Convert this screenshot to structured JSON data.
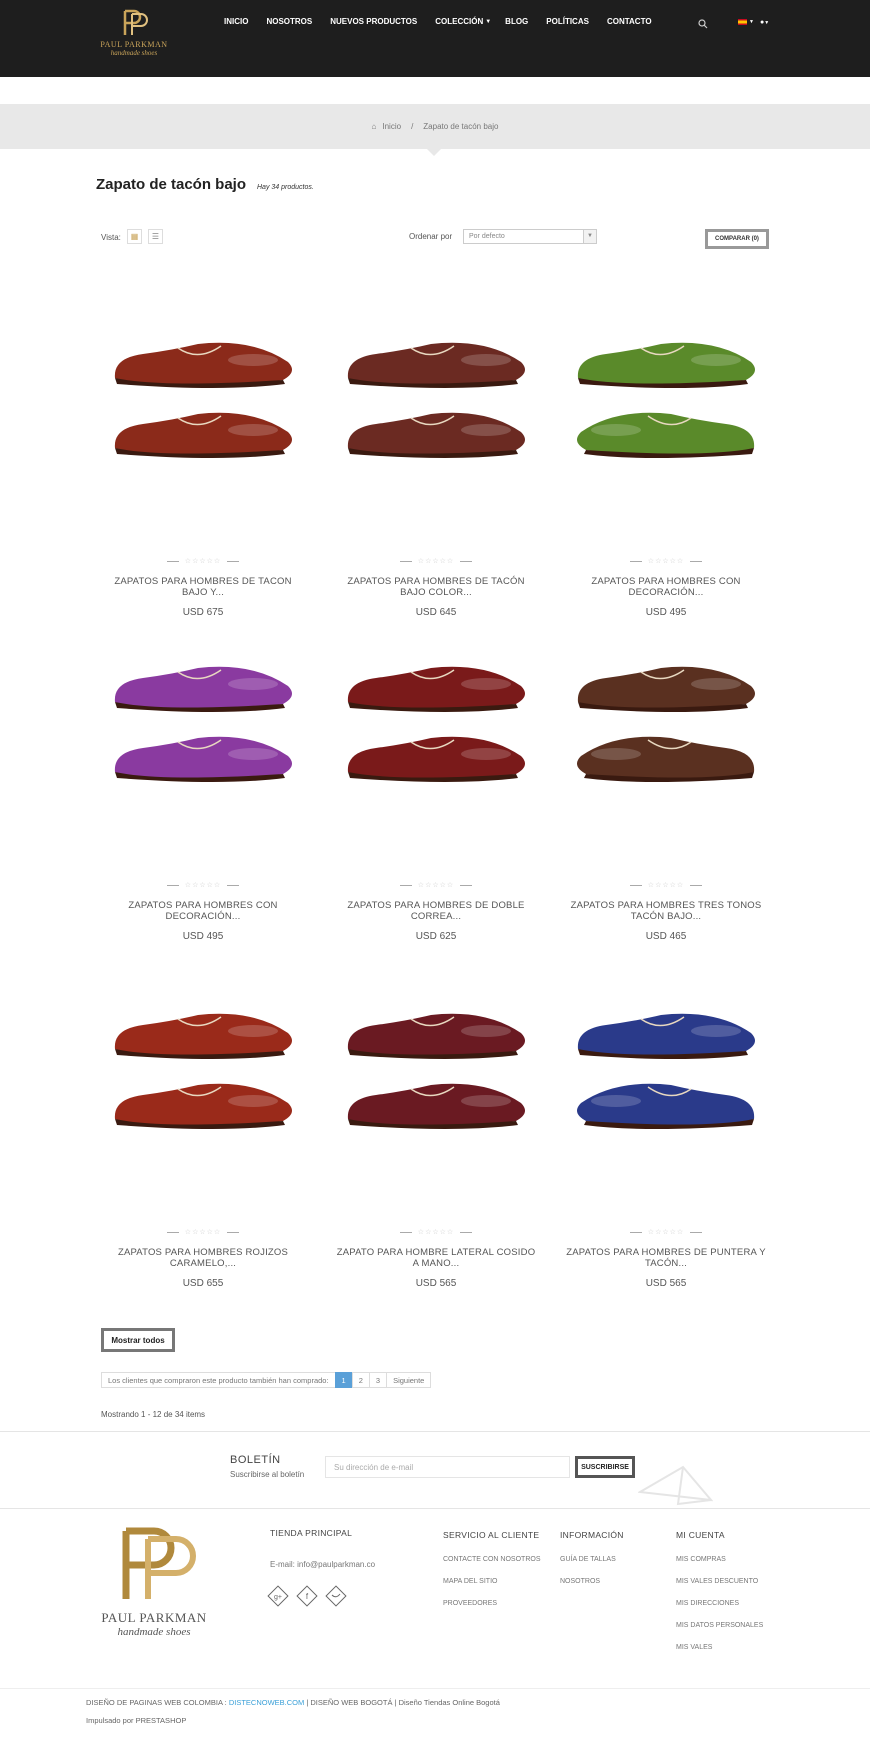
{
  "header": {
    "logo_name": "PAUL PARKMAN",
    "logo_sub": "handmade shoes",
    "nav": [
      "INICIO",
      "NOSOTROS",
      "NUEVOS PRODUCTOS",
      "COLECCIÓN",
      "BLOG",
      "POLÍTICAS",
      "CONTACTO"
    ],
    "nav_dropdown": "COLECCIÓN",
    "icons": [
      "search-icon",
      "flag-es-icon",
      "user-icon"
    ]
  },
  "breadcrumb": {
    "home_label": "Inicio",
    "separator": "/",
    "current": "Zapato de tacón bajo"
  },
  "category": {
    "title": "Zapato de tacón bajo",
    "count_text": "Hay 34 productos."
  },
  "toolbar": {
    "view_label": "Vista:",
    "sort_label": "Ordenar por",
    "sort_value": "Por defecto",
    "compare_label": "COMPARAR (0)"
  },
  "products": [
    {
      "name": "ZAPATOS PARA HOMBRES DE TACON BAJO Y...",
      "price": "USD 675",
      "color": "#8b2a1a"
    },
    {
      "name": "ZAPATOS PARA HOMBRES DE TACÓN BAJO COLOR...",
      "price": "USD 645",
      "color": "#6b2a22"
    },
    {
      "name": "ZAPATOS PARA HOMBRES CON DECORACIÓN...",
      "price": "USD 495",
      "color": "#5a8a2a"
    },
    {
      "name": "ZAPATOS PARA HOMBRES CON DECORACIÓN...",
      "price": "USD 495",
      "color": "#8a3aa0"
    },
    {
      "name": "ZAPATOS PARA HOMBRES DE DOBLE CORREA...",
      "price": "USD 625",
      "color": "#7a1a1a"
    },
    {
      "name": "ZAPATOS PARA HOMBRES TRES TONOS TACÓN BAJO...",
      "price": "USD 465",
      "color": "#5a3020"
    },
    {
      "name": "ZAPATOS PARA HOMBRES ROJIZOS CARAMELO,...",
      "price": "USD 655",
      "color": "#9a2a1a"
    },
    {
      "name": "ZAPATO PARA HOMBRE LATERAL COSIDO A MANO...",
      "price": "USD 565",
      "color": "#6a1a22"
    },
    {
      "name": "ZAPATOS PARA HOMBRES DE PUNTERA Y TACÓN...",
      "price": "USD 565",
      "color": "#2a3a8a"
    }
  ],
  "listing": {
    "show_all": "Mostrar todos",
    "pager_label": "Los clientes que compraron este producto también han comprado:",
    "pages": [
      "1",
      "2",
      "3"
    ],
    "current_page": "1",
    "next": "Siguiente",
    "showing": "Mostrando 1 - 12 de 34 items"
  },
  "newsletter": {
    "title": "BOLETÍN",
    "subtitle": "Suscribirse al boletín",
    "placeholder": "Su dirección de e-mail",
    "button": "SUSCRIBIRSE"
  },
  "footer": {
    "store_title": "TIENDA PRINCIPAL",
    "email": "E-mail: info@paulparkman.co",
    "social": [
      "google-plus-icon",
      "facebook-icon",
      "twitter-icon"
    ],
    "service_title": "SERVICIO AL CLIENTE",
    "service_links": [
      "CONTACTE CON NOSOTROS",
      "MAPA DEL SITIO",
      "PROVEEDORES"
    ],
    "info_title": "INFORMACIÓN",
    "info_links": [
      "GUÍA DE TALLAS",
      "NOSOTROS"
    ],
    "account_title": "MI CUENTA",
    "account_links": [
      "MIS COMPRAS",
      "MIS VALES DESCUENTO",
      "MIS DIRECCIONES",
      "MIS DATOS PERSONALES",
      "MIS VALES"
    ],
    "credits_a": "DISEÑO DE PAGINAS WEB COLOMBIA :",
    "credits_link": "DISTECNOWEB.COM",
    "credits_b": "| DISEÑO WEB BOGOTÁ | Diseño Tiendas Online Bogotá",
    "powered": "Impulsado por PRESTASHOP"
  },
  "colors": {
    "header_bg": "#1e1e1e",
    "gold": "#c9a45a",
    "pager_active": "#5aa0d8"
  }
}
